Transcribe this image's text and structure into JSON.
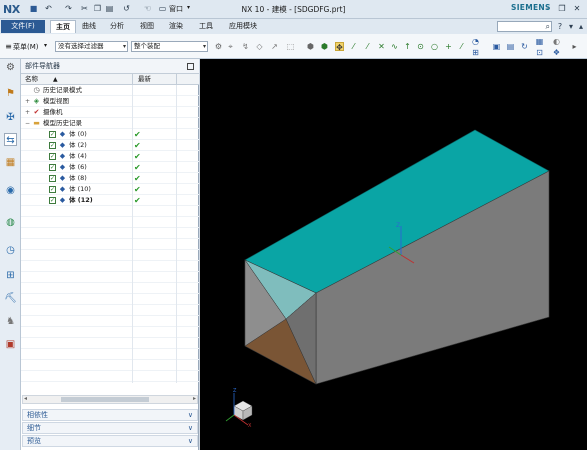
{
  "app": {
    "logo": "NX",
    "title": "NX 10 - 建模 - [SDGDFG.prt]",
    "brand": "SIEMENS"
  },
  "quick_access": [
    "save-icon",
    "undo-icon",
    "redo-icon",
    "cut-icon",
    "copy-icon",
    "paste-icon",
    "repeat-icon",
    "touch-mode-icon"
  ],
  "window_menu_label": "窗口",
  "menu": {
    "file": "文件(F)",
    "tabs": [
      "主页",
      "曲线",
      "分析",
      "视图",
      "渲染",
      "工具",
      "应用模块"
    ],
    "active_tab": "主页"
  },
  "toolbar": {
    "menu_label": "菜单(M)",
    "selection_filter": "没有选择过滤器",
    "assembly_scope": "整个装配"
  },
  "navigator": {
    "title": "部件导航器",
    "col_name": "名称",
    "col_latest": "最新",
    "rows": [
      {
        "label": "历史记录模式",
        "level": 0,
        "expander": "",
        "icon": "history-mode-icon",
        "checkbox": false,
        "latest": false,
        "bold": false
      },
      {
        "label": "模型视图",
        "level": 0,
        "expander": "+",
        "icon": "model-views-icon",
        "checkbox": false,
        "latest": false,
        "bold": false
      },
      {
        "label": "摄像机",
        "level": 0,
        "expander": "+",
        "icon": "camera-icon",
        "checkbox": false,
        "latest": false,
        "bold": false
      },
      {
        "label": "模型历史记录",
        "level": 0,
        "expander": "−",
        "icon": "folder-icon",
        "checkbox": false,
        "latest": false,
        "bold": false
      },
      {
        "label": "体 (0)",
        "level": 1,
        "expander": "",
        "icon": "body-feature-icon",
        "checkbox": true,
        "latest": true,
        "bold": false
      },
      {
        "label": "体 (2)",
        "level": 1,
        "expander": "",
        "icon": "body-feature-icon",
        "checkbox": true,
        "latest": true,
        "bold": false
      },
      {
        "label": "体 (4)",
        "level": 1,
        "expander": "",
        "icon": "body-feature-icon",
        "checkbox": true,
        "latest": true,
        "bold": false
      },
      {
        "label": "体 (6)",
        "level": 1,
        "expander": "",
        "icon": "body-feature-icon",
        "checkbox": true,
        "latest": true,
        "bold": false
      },
      {
        "label": "体 (8)",
        "level": 1,
        "expander": "",
        "icon": "body-feature-icon",
        "checkbox": true,
        "latest": true,
        "bold": false
      },
      {
        "label": "体 (10)",
        "level": 1,
        "expander": "",
        "icon": "body-feature-icon",
        "checkbox": true,
        "latest": true,
        "bold": false
      },
      {
        "label": "体 (12)",
        "level": 1,
        "expander": "",
        "icon": "body-feature-icon",
        "checkbox": true,
        "latest": true,
        "bold": true
      }
    ],
    "panels": [
      "相依性",
      "细节",
      "预览"
    ]
  },
  "left_strip_icons": [
    "settings-icon",
    "assembly-navigator-icon",
    "constraint-navigator-icon",
    "part-navigator-icon",
    "reuse-library-icon",
    "hd3d-tools-icon",
    "web-browser-icon",
    "history-icon",
    "process-studio-icon",
    "manufacturing-wizard-icon",
    "roles-icon"
  ],
  "colors": {
    "accent": "#2c5a94",
    "top_face": "#0aa5a5",
    "side_face": "#7a7a7a",
    "end_face_bottom": "#7a5535"
  }
}
